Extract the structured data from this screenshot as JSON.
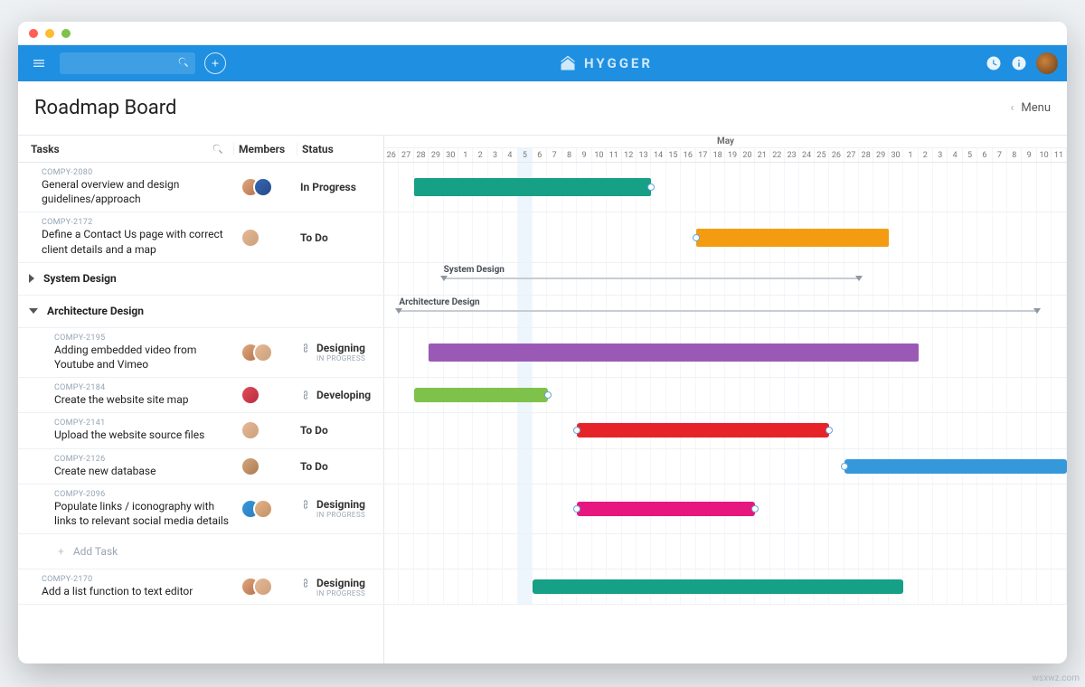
{
  "brand": "HYGGER",
  "page": {
    "title": "Roadmap Board",
    "menu": "Menu"
  },
  "columns": {
    "tasks": "Tasks",
    "members": "Members",
    "status": "Status"
  },
  "timeline": {
    "month": "May",
    "days": [
      26,
      27,
      28,
      29,
      30,
      1,
      2,
      3,
      4,
      5,
      6,
      7,
      8,
      9,
      10,
      11,
      12,
      13,
      14,
      15,
      16,
      17,
      18,
      19,
      20,
      21,
      22,
      23,
      24,
      25,
      26,
      27,
      28,
      29,
      30,
      1,
      2,
      3,
      4,
      5,
      6,
      7,
      8,
      9,
      10,
      11
    ],
    "todayIndex": 9
  },
  "groups": [
    {
      "name": "System Design",
      "expanded": false,
      "barStart": 4,
      "barEnd": 32
    },
    {
      "name": "Architecture Design",
      "expanded": true,
      "barStart": 1,
      "barEnd": 44
    }
  ],
  "tasks": [
    {
      "id": "COMPY-2080",
      "name": "General overview and design guidelines/approach",
      "status": "In Progress",
      "statusSub": "",
      "avatars": [
        "av1",
        "av2"
      ],
      "bar": {
        "start": 2,
        "end": 18,
        "cls": "teal fat"
      }
    },
    {
      "id": "COMPY-2172",
      "name": "Define a Contact Us page with correct client details and a map",
      "status": "To Do",
      "statusSub": "",
      "avatars": [
        "av3"
      ],
      "bar": {
        "start": 21,
        "end": 34,
        "cls": "orange fat"
      }
    },
    {
      "id": "COMPY-2195",
      "name": "Adding embedded video from Youtube and Vimeo",
      "status": "Designing",
      "statusSub": "IN PROGRESS",
      "icon": true,
      "avatars": [
        "av1",
        "av3"
      ],
      "bar": {
        "start": 3,
        "end": 36,
        "cls": "purple fat"
      }
    },
    {
      "id": "COMPY-2184",
      "name": "Create the website site map",
      "status": "Developing",
      "statusSub": "",
      "icon": true,
      "avatars": [
        "av4"
      ],
      "bar": {
        "start": 2,
        "end": 11,
        "cls": "green"
      }
    },
    {
      "id": "COMPY-2141",
      "name": "Upload the website source files",
      "status": "To Do",
      "statusSub": "",
      "avatars": [
        "av3"
      ],
      "bar": {
        "start": 13,
        "end": 30,
        "cls": "redbar"
      }
    },
    {
      "id": "COMPY-2126",
      "name": "Create new database",
      "status": "To Do",
      "statusSub": "",
      "avatars": [
        "av5"
      ],
      "bar": {
        "start": 31,
        "end": 46,
        "cls": "bluebar"
      }
    },
    {
      "id": "COMPY-2096",
      "name": "Populate links / iconography with links to relevant social media details",
      "status": "Designing",
      "statusSub": "IN PROGRESS",
      "icon": true,
      "avatars": [
        "av6",
        "av7"
      ],
      "bar": {
        "start": 13,
        "end": 25,
        "cls": "pink"
      }
    },
    {
      "id": "COMPY-2170",
      "name": "Add a list function to text editor",
      "status": "Designing",
      "statusSub": "IN PROGRESS",
      "icon": true,
      "avatars": [
        "av1",
        "av3"
      ],
      "bar": {
        "start": 10,
        "end": 35,
        "cls": "teal"
      }
    }
  ],
  "addTask": "Add Task",
  "watermark": "wsxwz.com"
}
